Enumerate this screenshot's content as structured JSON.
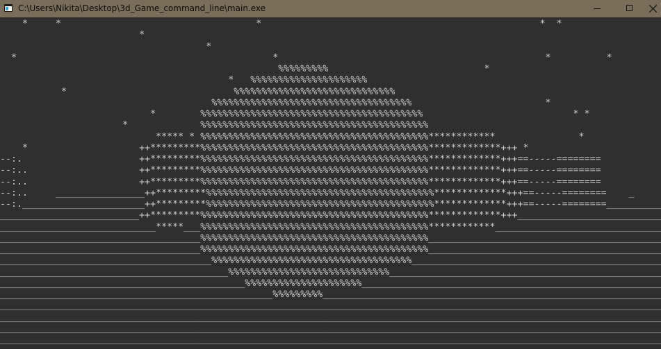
{
  "window": {
    "title": "C:\\Users\\Nikita\\Desktop\\3d_Game_command_line\\main.exe",
    "icon": "console-app-icon",
    "controls": [
      "minimize-icon",
      "maximize-icon",
      "close-icon"
    ]
  },
  "console": {
    "background": "#2f2f2f",
    "foreground": "#cccccc",
    "text": "    *     *                                   *                                                  *  *\n                         *\n                                     *\n  *                                              *                                                *          *\n                                                  %%%%%%%%%                            *\n                                         *   %%%%%%%%%%%%%%%%%%%%%\n           *                              %%%%%%%%%%%%%%%%%%%%%%%%%%%%%\n                                      %%%%%%%%%%%%%%%%%%%%%%%%%%%%%%%%%%%%                        *\n                           *        %%%%%%%%%%%%%%%%%%%%%%%%%%%%%%%%%%%%%%%%                           * *\n                      *             %%%%%%%%%%%%%%%%%%%%%%%%%%%%%%%%%%%%%%%%%\n                            ***** * %%%%%%%%%%%%%%%%%%%%%%%%%%%%%%%%%%%%%%%%%************               *\n    *                    ++*********%%%%%%%%%%%%%%%%%%%%%%%%%%%%%%%%%%%%%%%%%*************+++ *\n--:.                     ++*********%%%%%%%%%%%%%%%%%%%%%%%%%%%%%%%%%%%%%%%%%*************+++==-----========\n--:..                    ++*********%%%%%%%%%%%%%%%%%%%%%%%%%%%%%%%%%%%%%%%%%*************+++==-----========\n--:..                    ++*********%%%%%%%%%%%%%%%%%%%%%%%%%%%%%%%%%%%%%%%%%*************+++==-----========\n--:..     ________________++*********%%%%%%%%%%%%%%%%%%%%%%%%%%%%%%%%%%%%%%%%%*************+++==-----========    _\n--:.______________________++*********%%%%%%%%%%%%%%%%%%%%%%%%%%%%%%%%%%%%%%%%%*************+++==-----========__________\n_________________________++*********%%%%%%%%%%%%%%%%%%%%%%%%%%%%%%%%%%%%%%%%%*************+++____________________________\n____________________________*****___%%%%%%%%%%%%%%%%%%%%%%%%%%%%%%%%%%%%%%%%%************___________________________________\n____________________________________%%%%%%%%%%%%%%%%%%%%%%%%%%%%%%%%%%%%%%%%%______________________________________________\n____________________________________%%%%%%%%%%%%%%%%%%%%%%%%%%%%%%%%%%%%%%%%%______________________________________________\n______________________________________%%%%%%%%%%%%%%%%%%%%%%%%%%%%%%%%%%%%____________________________________________________\n_________________________________________%%%%%%%%%%%%%%%%%%%%%%%%%%%%%_______________________________________________________\n____________________________________________%%%%%%%%%%%%%%%%%%%%%______________________________________________________________\n_________________________________________________%%%%%%%%%_______________________________________________________________________\n______________________________________________________________________________________________________________________________\n______________________________________________________________________________________________________________________________\n______________________________________________________________________________________________________________________________\n______________________________________________________________________________________________________________________________"
  }
}
